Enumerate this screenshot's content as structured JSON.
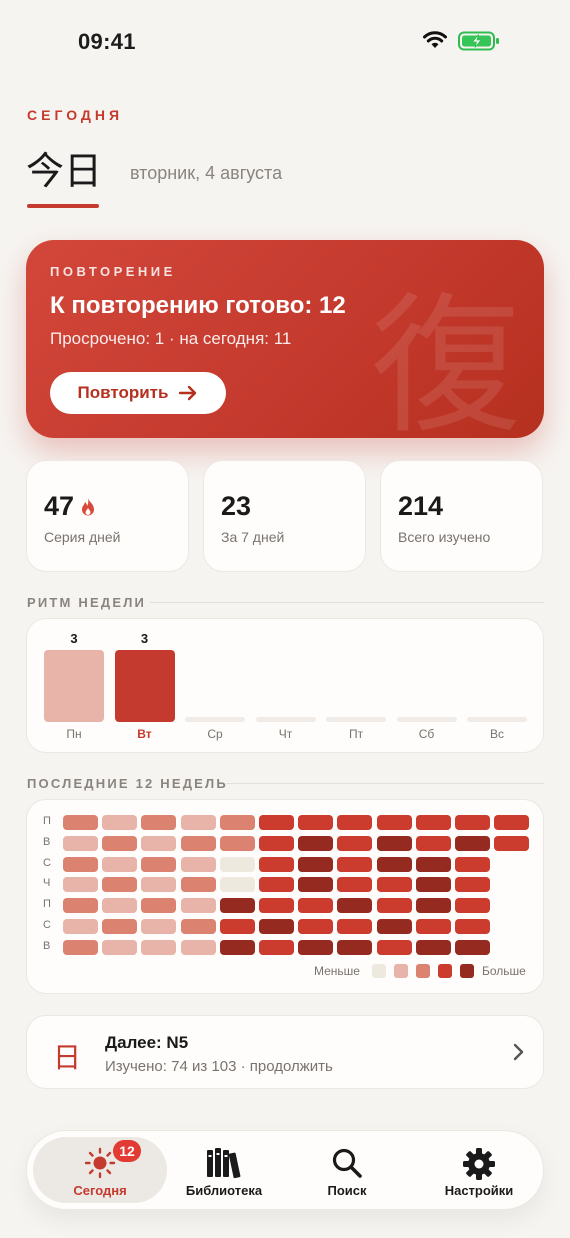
{
  "status_bar": {
    "time": "09:41"
  },
  "header": {
    "eyebrow": "СЕГОДНЯ",
    "kanji": "今日",
    "date": "вторник, 4 августа"
  },
  "review": {
    "eyebrow": "ПОВТОРЕНИЕ",
    "title": "К повторению готово: 12",
    "subtitle": "Просрочено: 1 · на сегодня: 11",
    "button_label": "Повторить",
    "watermark": "復"
  },
  "stats": [
    {
      "value": "47",
      "label": "Серия дней",
      "icon": "flame-icon"
    },
    {
      "value": "23",
      "label": "За 7 дней"
    },
    {
      "value": "214",
      "label": "Всего изучено"
    }
  ],
  "week_rhythm": {
    "title": "РИТМ НЕДЕЛИ",
    "days": [
      {
        "label": "Пн",
        "count": 3,
        "active": false
      },
      {
        "label": "Вт",
        "count": 3,
        "active": true
      },
      {
        "label": "Ср",
        "count": 0,
        "active": false
      },
      {
        "label": "Чт",
        "count": 0,
        "active": false
      },
      {
        "label": "Пт",
        "count": 0,
        "active": false
      },
      {
        "label": "Сб",
        "count": 0,
        "active": false
      },
      {
        "label": "Вс",
        "count": 0,
        "active": false
      }
    ],
    "colors": {
      "past": "#e8b3a9",
      "today": "#c53a2e"
    }
  },
  "heatmap": {
    "title": "ПОСЛЕДНИЕ 12 НЕДЕЛЬ",
    "row_labels": [
      "П",
      "В",
      "С",
      "Ч",
      "П",
      "С",
      "В"
    ],
    "levels": [
      [
        2,
        1,
        2,
        1,
        2,
        3,
        3,
        3,
        3,
        3,
        3,
        3
      ],
      [
        1,
        2,
        1,
        2,
        2,
        3,
        4,
        3,
        4,
        3,
        4,
        3
      ],
      [
        2,
        1,
        2,
        1,
        0,
        3,
        4,
        3,
        4,
        4,
        3,
        -1
      ],
      [
        1,
        2,
        1,
        2,
        0,
        3,
        4,
        3,
        3,
        4,
        3,
        -1
      ],
      [
        2,
        1,
        2,
        1,
        4,
        3,
        3,
        4,
        3,
        4,
        3,
        -1
      ],
      [
        1,
        2,
        1,
        2,
        3,
        4,
        3,
        3,
        4,
        3,
        3,
        -1
      ],
      [
        2,
        1,
        1,
        1,
        4,
        3,
        4,
        4,
        3,
        4,
        4,
        -1
      ]
    ],
    "palette": [
      "#ede9df",
      "#e8b3a9",
      "#dc8270",
      "#cc3c2e",
      "#952a20"
    ],
    "legend_less": "Меньше",
    "legend_more": "Больше"
  },
  "next": {
    "kanji": "日",
    "title": "Далее: N5",
    "subtitle": "Изучено: 74 из 103 · продолжить"
  },
  "tabbar": {
    "items": [
      {
        "label": "Сегодня",
        "icon": "sun-icon",
        "active": true,
        "badge": "12"
      },
      {
        "label": "Библиотека",
        "icon": "books-icon",
        "active": false
      },
      {
        "label": "Поиск",
        "icon": "search-icon",
        "active": false
      },
      {
        "label": "Настройки",
        "icon": "gear-icon",
        "active": false
      }
    ]
  },
  "colors": {
    "accent": "#c53a2e",
    "background": "#f6f4f1"
  }
}
